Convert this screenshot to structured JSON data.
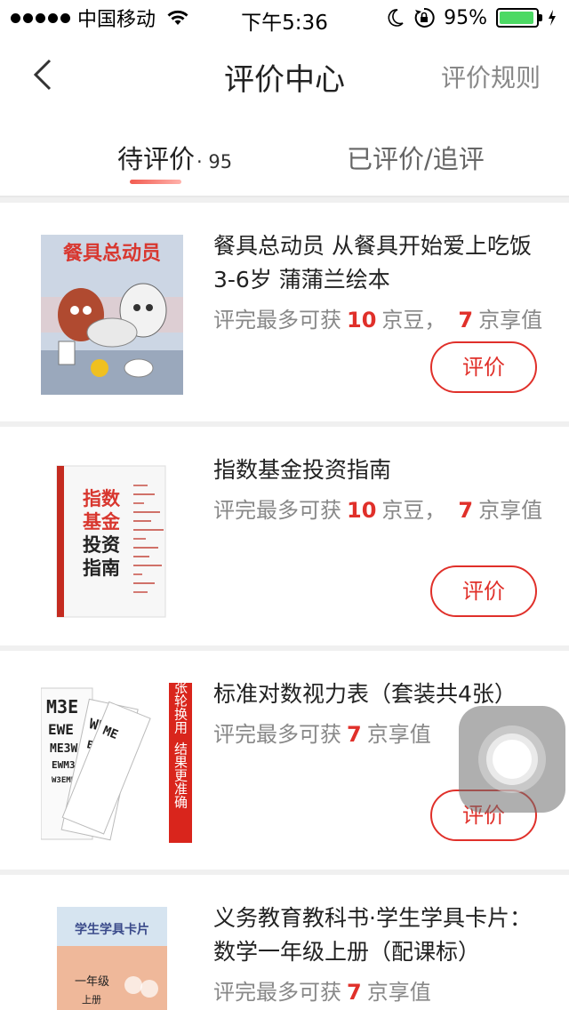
{
  "status_bar": {
    "carrier": "中国移动",
    "time": "下午5:36",
    "battery_percent": "95%",
    "battery_level": 0.95,
    "icons": [
      "signal-dots-icon",
      "wifi-icon",
      "moon-icon",
      "rotation-lock-icon",
      "battery-icon",
      "charging-icon"
    ]
  },
  "nav": {
    "title": "评价中心",
    "rules_label": "评价规则",
    "back_icon": "chevron-left-icon"
  },
  "tabs": {
    "pending_label": "待评价",
    "pending_count": "· 95",
    "done_label": "已评价/追评",
    "accent_gradient": [
      "#f25b50",
      "#ffb2ab"
    ]
  },
  "items": [
    {
      "title": "餐具总动员 从餐具开始爱上吃饭 3-6岁 蒲蒲兰绘本",
      "reward_prefix": "评完最多可获",
      "beans": "10",
      "beans_unit": "京豆，",
      "value": "7",
      "value_unit": "京享值",
      "button": "评价",
      "cover_text": "餐具总动员"
    },
    {
      "title": "指数基金投资指南",
      "reward_prefix": "评完最多可获",
      "beans": "10",
      "beans_unit": "京豆，",
      "value": "7",
      "value_unit": "京享值",
      "button": "评价",
      "cover_text": [
        "指数",
        "基金",
        "投资",
        "指南"
      ]
    },
    {
      "title": "标准对数视力表（套装共4张）",
      "reward_prefix": "评完最多可获",
      "value": "7",
      "value_unit": "京享值",
      "button": "评价",
      "cover_text": [
        "四张轮换用",
        "结果更准确"
      ]
    },
    {
      "title": "义务教育教科书·学生学具卡片：数学一年级上册（配课标）",
      "reward_prefix": "评完最多可获",
      "value": "7",
      "value_unit": "京享值",
      "cover_text": [
        "学生学具卡片",
        "一年级",
        "上册"
      ]
    }
  ],
  "colors": {
    "accent_red": "#e0302a",
    "battery_green": "#4cd964",
    "background": "#f0f0f0"
  }
}
